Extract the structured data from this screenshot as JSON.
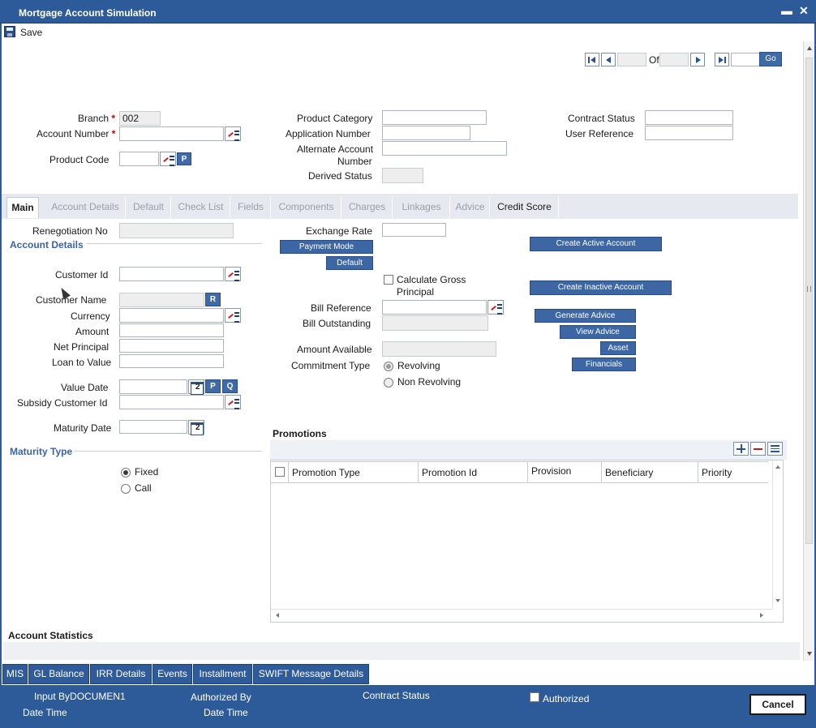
{
  "window": {
    "title": "Mortgage Account Simulation",
    "minimize": "▬",
    "close": "✕"
  },
  "toolbar": {
    "save": "Save"
  },
  "pager": {
    "of": "Of",
    "go": "Go"
  },
  "header": {
    "branch_label": "Branch",
    "branch_value": "002",
    "account_number_label": "Account Number",
    "product_code_label": "Product Code",
    "product_code_button": "P",
    "product_category_label": "Product Category",
    "application_number_label": "Application Number",
    "alternate_account_label_1": "Alternate Account",
    "alternate_account_label_2": "Number",
    "derived_status_label": "Derived Status",
    "contract_status_label": "Contract Status",
    "user_reference_label": "User Reference",
    "required": "*"
  },
  "tabs": [
    {
      "label": "Main",
      "state": "active"
    },
    {
      "label": "Account Details",
      "state": "disabled"
    },
    {
      "label": "Default",
      "state": "disabled"
    },
    {
      "label": "Check List",
      "state": "disabled"
    },
    {
      "label": "Fields",
      "state": "disabled"
    },
    {
      "label": "Components",
      "state": "disabled"
    },
    {
      "label": "Charges",
      "state": "disabled"
    },
    {
      "label": "Linkages",
      "state": "disabled"
    },
    {
      "label": "Advice",
      "state": "disabled"
    },
    {
      "label": "Credit Score",
      "state": "enabled"
    }
  ],
  "main": {
    "renegotiation_no_label": "Renegotiation No",
    "account_details_title": "Account Details",
    "customer_id_label": "Customer Id",
    "customer_name_label": "Customer Name",
    "customer_name_button": "R",
    "currency_label": "Currency",
    "amount_label": "Amount",
    "net_principal_label": "Net Principal",
    "loan_to_value_label": "Loan to Value",
    "value_date_label": "Value Date",
    "value_date_p": "P",
    "value_date_q": "Q",
    "subsidy_customer_id_label": "Subsidy Customer Id",
    "maturity_date_label": "Maturity Date",
    "maturity_type_title": "Maturity Type",
    "maturity_fixed": "Fixed",
    "maturity_call": "Call",
    "exchange_rate_label": "Exchange Rate",
    "payment_mode_button": "Payment Mode",
    "default_button": "Default",
    "calc_gross_1": "Calculate Gross",
    "calc_gross_2": "Principal",
    "bill_reference_label": "Bill Reference",
    "bill_outstanding_label": "Bill Outstanding",
    "amount_available_label": "Amount Available",
    "commitment_type_label": "Commitment Type",
    "commitment_revolving": "Revolving",
    "commitment_non_revolving": "Non Revolving",
    "create_active_account": "Create Active Account",
    "create_inactive_account": "Create Inactive Account",
    "generate_advice": "Generate Advice",
    "view_advice": "View Advice",
    "asset": "Asset",
    "financials": "Financials"
  },
  "promotions": {
    "title": "Promotions",
    "columns": [
      "Promotion Type",
      "Promotion Id",
      "Provision",
      "Beneficiary",
      "Priority"
    ]
  },
  "account_statistics": {
    "title": "Account Statistics"
  },
  "bottom_tabs": [
    "MIS",
    "GL Balance",
    "IRR Details",
    "Events",
    "Installment",
    "SWIFT Message Details"
  ],
  "footer": {
    "input_by": "Input ByDOCUMEN1",
    "date_time_1": "Date Time",
    "authorized_by": "Authorized By",
    "date_time_2": "Date Time",
    "contract_status": "Contract Status",
    "authorized": "Authorized",
    "cancel": "Cancel"
  }
}
